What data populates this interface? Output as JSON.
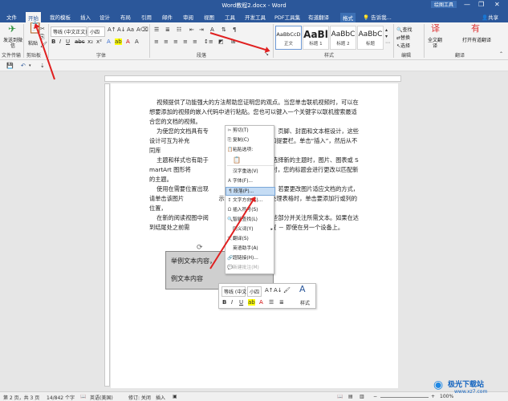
{
  "window": {
    "title": "Word教程2.docx - Word",
    "context_tool": "绘图工具",
    "login": "登录",
    "minimize": "—",
    "restore": "❐",
    "close": "✕"
  },
  "tabs": [
    "文件",
    "开始",
    "我的模板",
    "插入",
    "设计",
    "布局",
    "引用",
    "邮件",
    "审阅",
    "视图",
    "工具",
    "开发工具",
    "PDF工具集",
    "有道翻译",
    "格式"
  ],
  "tell_me": "告诉我...",
  "share": "共享",
  "ribbon": {
    "send": "发送到微信",
    "paste": "粘贴",
    "font_name": "等线 (中文正文)",
    "font_size": "小四",
    "groups": {
      "file_transfer": "文件传输",
      "clipboard": "剪贴板",
      "font": "字体",
      "paragraph": "段落",
      "styles": "样式",
      "edit": "编辑",
      "translate": "翻译"
    },
    "styles": [
      {
        "preview": "AaBbCcD",
        "name": "正文"
      },
      {
        "preview": "AaBl",
        "name": "标题 1"
      },
      {
        "preview": "AaBbC",
        "name": "标题 2"
      },
      {
        "preview": "AaBbC",
        "name": "标题"
      }
    ],
    "edit_items": [
      "查找",
      "替换",
      "选择"
    ],
    "full_translate": "全文翻译",
    "open_youdao": "打开有道翻译"
  },
  "document": {
    "paragraphs": [
      "    视频提供了功能强大的方法帮助您证明您的观点。当您单击联机视频时，可以在想要添加的视频的嵌入代码中进行粘贴。您也可以键入一个关键字以联机搜索最适合您的文档的视频。",
      "    为使您的文档具有专                   提供了页眉、页脚、封面和文本框设计，这些设计可互为补充                   匹配的封面、页眉和提要栏。单击“插入”，然后从不同库",
      "    主题和样式也有助于                   单击设计并选择新的主题时，图片、图表或 SmartArt 图形将                   主题。当应用样式时，您的标题会进行更改以匹配新的主题。",
      "    使用在需要位置出现                   中保存时间。若要更改图片适应文档的方式，请单击该图片                   示布局选项按钮。当处理表格时，单击要添加行或列的位置，",
      "    在新的阅读视图中阅                   折叠文档某些部分并关注所需文本。如果在达到结尾处之前需                   会记住您的停止位置 － 即使在另一个设备上。"
    ],
    "textbox_line1": "举例文本内容，",
    "textbox_line2": "例文本内容"
  },
  "context_menu": [
    {
      "icon": "✂",
      "label": "剪切(T)",
      "enabled": true
    },
    {
      "icon": "⎘",
      "label": "复制(C)",
      "enabled": true
    },
    {
      "icon": "📋",
      "label": "粘贴选项:",
      "enabled": true
    },
    {
      "icon": "",
      "label": "",
      "enabled": true
    },
    {
      "icon": "",
      "label": "汉字重选(V)",
      "enabled": true
    },
    {
      "icon": "A",
      "label": "字体(F)...",
      "enabled": true
    },
    {
      "icon": "¶",
      "label": "段落(P)...",
      "enabled": true,
      "highlighted": true
    },
    {
      "icon": "↕",
      "label": "文字方向(X)...",
      "enabled": true
    },
    {
      "icon": "Ω",
      "label": "插入符号(S)",
      "enabled": true
    },
    {
      "icon": "🔍",
      "label": "智能查找(L)",
      "enabled": true
    },
    {
      "icon": "",
      "label": "同义词(Y)",
      "enabled": true
    },
    {
      "icon": "文",
      "label": "翻译(S)",
      "enabled": true
    },
    {
      "icon": "",
      "label": "英语助手(A)",
      "enabled": true
    },
    {
      "icon": "🔗",
      "label": "超链接(H)...",
      "enabled": true
    },
    {
      "icon": "💬",
      "label": "新建批注(M)",
      "enabled": false
    }
  ],
  "mini_toolbar": {
    "font": "等线 (中文",
    "size": "小四",
    "styles_label": "样式"
  },
  "status": {
    "page": "第 2 页，共 3 页",
    "words": "14/842 个字",
    "language": "英语(美国)",
    "track": "修订: 关闭",
    "insert": "插入",
    "zoom": "100%"
  },
  "watermark": {
    "brand": "极光下载站",
    "url": "www.xz7.com"
  },
  "colors": {
    "brand": "#2b579a",
    "ribbon": "#f3f3f3",
    "arrow": "#e02020"
  }
}
